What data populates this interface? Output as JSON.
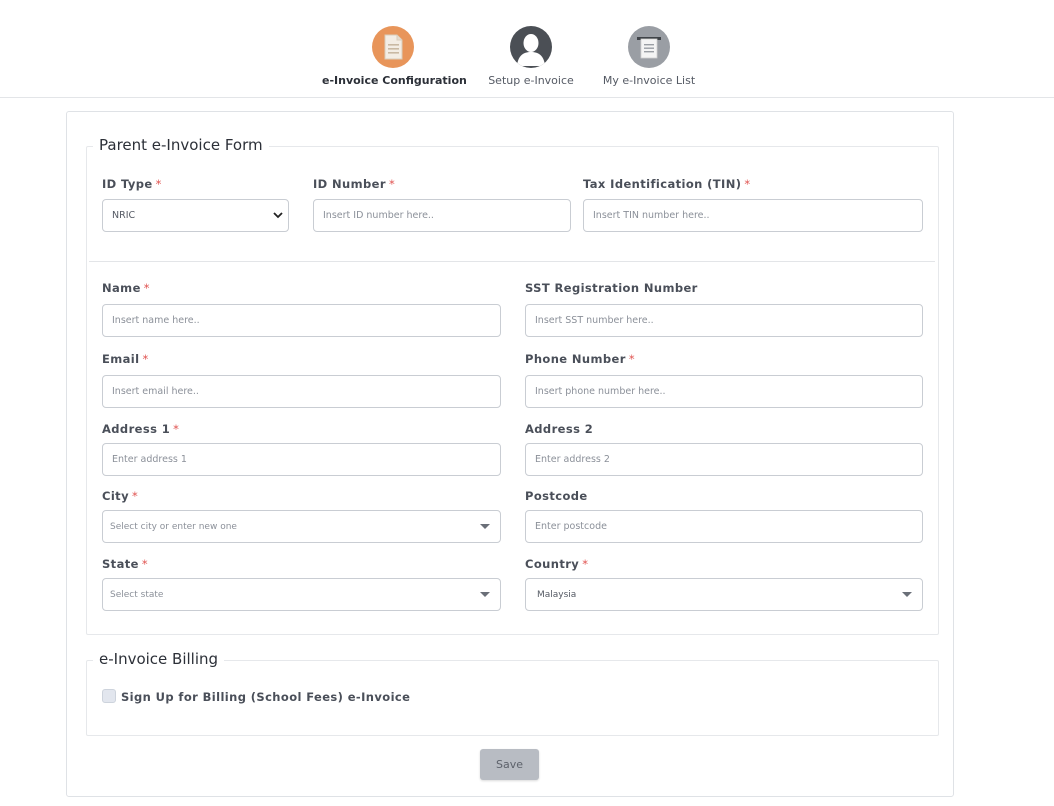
{
  "stepper": {
    "steps": [
      {
        "label": "e-Invoice Configuration",
        "icon": "document-icon",
        "color": "#e8955a",
        "active": true
      },
      {
        "label": "Setup e-Invoice",
        "icon": "user-icon",
        "color": "#4b4f55",
        "active": false
      },
      {
        "label": "My e-Invoice List",
        "icon": "receipt-list-icon",
        "color": "#9a9ea4",
        "active": false
      }
    ]
  },
  "parent_form": {
    "title": "Parent e-Invoice Form",
    "required_mark": "*",
    "id_type": {
      "label": "ID Type",
      "value": "NRIC"
    },
    "id_number": {
      "label": "ID Number",
      "placeholder": "Insert ID number here.."
    },
    "tin": {
      "label": "Tax Identification (TIN)",
      "placeholder": "Insert TIN number here.."
    },
    "name": {
      "label": "Name",
      "placeholder": "Insert name here.."
    },
    "sst": {
      "label": "SST Registration Number",
      "placeholder": "Insert SST number here.."
    },
    "email": {
      "label": "Email",
      "placeholder": "Insert email here.."
    },
    "phone": {
      "label": "Phone Number",
      "placeholder": "Insert phone number here.."
    },
    "address1": {
      "label": "Address 1",
      "placeholder": "Enter address 1"
    },
    "address2": {
      "label": "Address 2",
      "placeholder": "Enter address 2"
    },
    "city": {
      "label": "City",
      "placeholder": "Select city or enter new one"
    },
    "postcode": {
      "label": "Postcode",
      "placeholder": "Enter postcode"
    },
    "state": {
      "label": "State",
      "placeholder": "Select state"
    },
    "country": {
      "label": "Country",
      "value": "Malaysia"
    }
  },
  "billing": {
    "title": "e-Invoice Billing",
    "checkbox_label": "Sign Up for Billing (School Fees) e-Invoice",
    "checked": false
  },
  "save_label": "Save"
}
